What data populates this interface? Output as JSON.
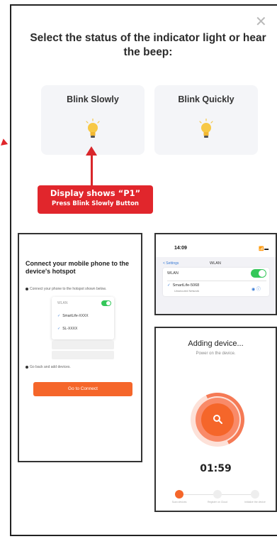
{
  "dialog": {
    "close_icon": "close-icon",
    "title": "Select the status of the indicator light or hear the beep:"
  },
  "options": [
    {
      "label": "Blink Slowly",
      "icon": "bulb-icon"
    },
    {
      "label": "Blink Quickly",
      "icon": "bulb-icon"
    }
  ],
  "callout": {
    "line1": "Display shows “P1”",
    "line2": "Press Blink Slowly Button",
    "color": "#e1262c"
  },
  "hotspot_panel": {
    "title": "Connect your mobile phone to the device's hotspot",
    "step1": "Connect your phone to the hotspot shown below.",
    "card_header": "WLAN",
    "networks": [
      "SmartLife-XXXX",
      "SL-XXXX"
    ],
    "step2": "Go back and add devices.",
    "button": "Go to Connect"
  },
  "wlan_panel": {
    "time": "14:09",
    "status": "📶 ▬",
    "back": "< Settings",
    "header": "WLAN",
    "row_label": "WLAN",
    "network_name": "SmartLife-5068",
    "network_sub": "Unsecured Network"
  },
  "adding_panel": {
    "title": "Adding device...",
    "subtitle": "Power on the device.",
    "timer": "01:59",
    "steps": [
      "Scan devices",
      "Register on Cloud",
      "Initialize the device"
    ]
  },
  "colors": {
    "accent": "#f5662a",
    "toggle": "#34c759",
    "link": "#3a7bd5"
  }
}
